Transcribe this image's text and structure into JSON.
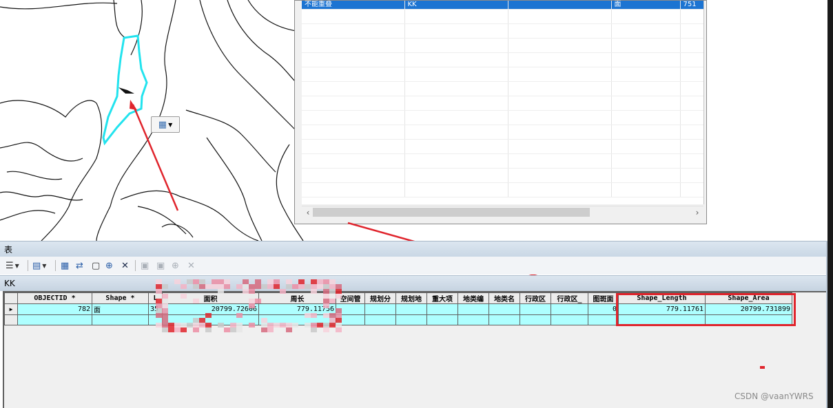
{
  "float_window": {
    "selected_row": [
      "不能重叠",
      "KK",
      "",
      "面",
      "751"
    ],
    "empty_rows": 13
  },
  "panel": {
    "title": "表",
    "table_tab": "KK"
  },
  "toolbar": {
    "table_options_icon": "table-options-icon",
    "related_tables_icon": "related-tables-icon",
    "select_by_attributes_icon": "select-by-attributes-icon",
    "switch_selection_icon": "switch-selection-icon",
    "clear_selection_icon": "clear-selection-icon",
    "zoom_to_selected_icon": "zoom-to-selected-icon",
    "delete_selected_icon": "delete-selected-icon",
    "copy_disabled_icon": "copy-icon",
    "paste_disabled_icon": "paste-icon",
    "zoom_disabled_icon": "zoom-icon",
    "delete_disabled_icon": "delete-icon"
  },
  "attribute_table": {
    "columns": [
      "OBJECTID *",
      "Shape *",
      "L",
      "面积",
      "周长",
      "空间管",
      "规划分",
      "规划地",
      "重大项",
      "地类编",
      "地类名",
      "行政区",
      "行政区_",
      "图斑面",
      "Shape_Length",
      "Shape_Area"
    ],
    "rows": [
      [
        "782",
        "面",
        "35",
        "20799.72606",
        "779.11756",
        "",
        "",
        "",
        "",
        "",
        "",
        "",
        "",
        "0",
        "779.11761",
        "20799.731899"
      ]
    ]
  },
  "watermark": "CSDN @vaanYWRS",
  "colors": {
    "highlight_red": "#e0242c",
    "row_cyan": "#aeffff",
    "selection_blue": "#1c74d2",
    "polygon_cyan": "#22e3ee"
  }
}
